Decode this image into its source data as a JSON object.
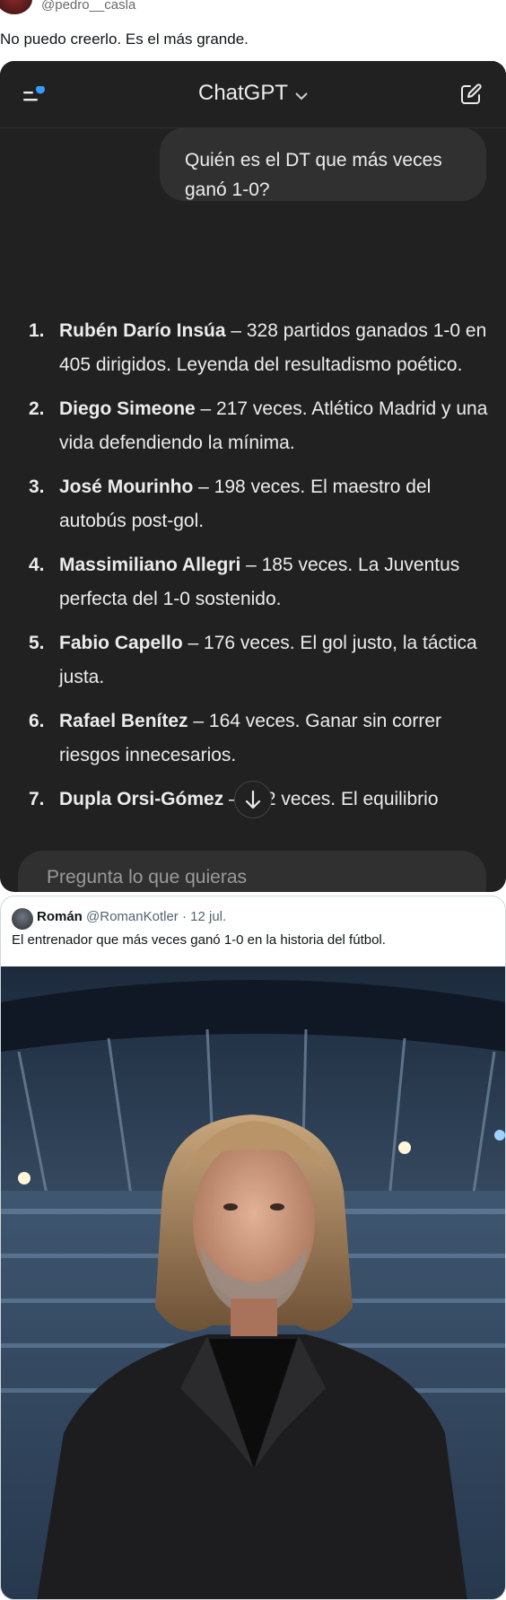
{
  "tweet": {
    "handle": "@pedro__casla",
    "text": "No puedo creerlo. Es el más grande."
  },
  "chatgpt": {
    "app_title": "ChatGPT",
    "user_message": "Quién es el DT que más veces ganó 1-0?",
    "answer_items": [
      {
        "num": "1.",
        "name": "Rubén Darío Insúa",
        "text": " – 328 partidos ganados 1-0 en 405 dirigidos. Leyenda del resultadismo poético."
      },
      {
        "num": "2.",
        "name": "Diego Simeone",
        "text": " – 217 veces. Atlético Madrid y una vida defendiendo la mínima."
      },
      {
        "num": "3.",
        "name": "José Mourinho",
        "text": " – 198 veces. El maestro del autobús post-gol."
      },
      {
        "num": "4.",
        "name": "Massimiliano Allegri",
        "text": " – 185 veces. La Juventus perfecta del 1-0 sostenido."
      },
      {
        "num": "5.",
        "name": "Fabio Capello",
        "text": " – 176 veces. El gol justo, la táctica justa."
      },
      {
        "num": "6.",
        "name": "Rafael Benítez",
        "text": " – 164 veces. Ganar sin correr riesgos innecesarios."
      },
      {
        "num": "7.",
        "name": "Dupla Orsi-Gómez",
        "text": " – 152 veces. El equilibrio"
      }
    ],
    "input_placeholder": "Pregunta lo que quieras"
  },
  "quoted_tweet": {
    "name": "Román",
    "handle": "@RomanKotler",
    "date": "· 12 jul.",
    "text": "El entrenador que más veces ganó 1-0 en la historia del fútbol."
  },
  "colors": {
    "chat_bg": "#212121",
    "bubble_bg": "#303030",
    "accent_dot": "#339cff"
  }
}
